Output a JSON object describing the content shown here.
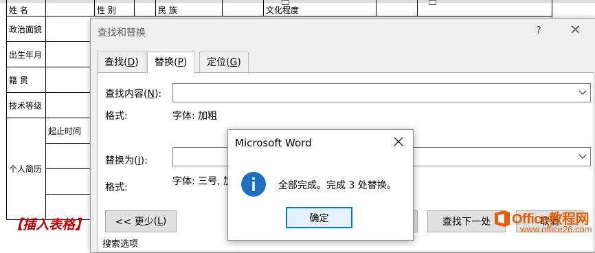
{
  "document": {
    "row1": {
      "c1": "姓    名",
      "c3": "性    别",
      "c5": "民    族",
      "c7": "文化程度"
    },
    "row_labels": [
      "政治面貌",
      "出生年月",
      "籍    贯",
      "技术等级",
      "个人简历"
    ],
    "resume_sub": "起止时间",
    "caption": "【插入表格】"
  },
  "find_replace": {
    "title": "查找和替换",
    "help": "?",
    "close": "✕",
    "tabs": [
      {
        "label": "查找",
        "key": "D"
      },
      {
        "label": "替换",
        "key": "P"
      },
      {
        "label": "定位",
        "key": "G"
      }
    ],
    "find": {
      "label": "查找内容",
      "key": "N",
      "value": "",
      "format_label": "格式:",
      "format_value": "字体: 加粗"
    },
    "replace": {
      "label": "替换为",
      "key": "I",
      "value": "",
      "format_label": "格式:",
      "format_value": "字体: 三号, 加"
    },
    "less_button": {
      "label": "<< 更少",
      "key": "L"
    },
    "find_next_button": {
      "label": "查找下一处"
    },
    "cancel_button": {
      "label": "取消"
    },
    "footer": "搜索选项"
  },
  "message_box": {
    "title": "Microsoft Word",
    "message": "全部完成。完成 3 处替换。",
    "ok": "确定"
  },
  "watermark": {
    "brand": "Office教程网",
    "url": "www.office26.com"
  },
  "colors": {
    "accent": "#0078d7",
    "info_icon": "#1f6fc1",
    "caption_red": "#c00000",
    "watermark": "#e85d04"
  }
}
